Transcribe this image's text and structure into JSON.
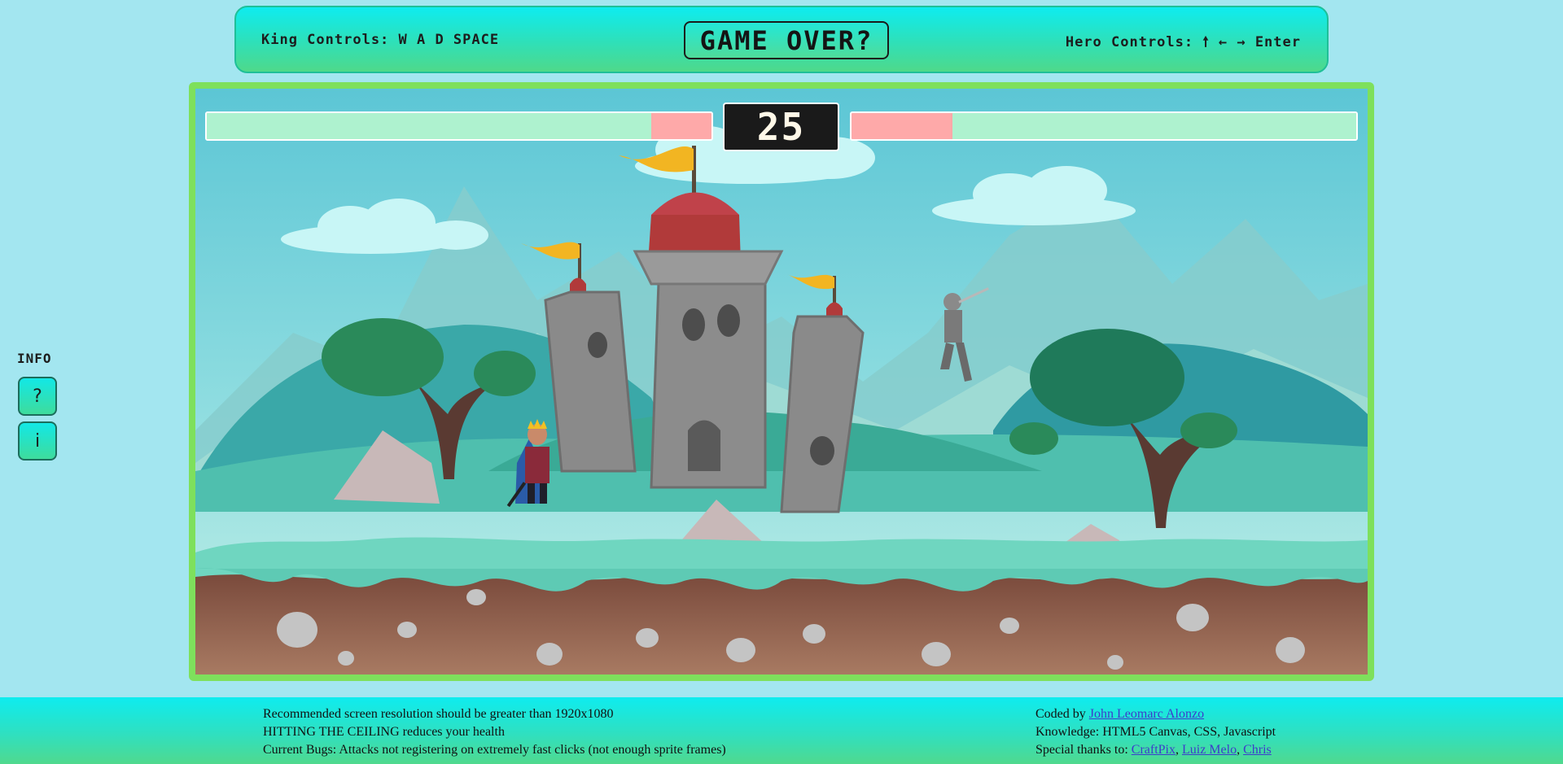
{
  "header": {
    "king_controls": "King Controls: W A D SPACE",
    "game_over": "GAME OVER?",
    "hero_controls": "Hero Controls: 🠕 ← → Enter"
  },
  "info": {
    "title": "INFO",
    "help_button": "?",
    "info_button": "i"
  },
  "hud": {
    "timer": "25",
    "king_health_fraction": 0.88,
    "hero_health_fraction": 0.8
  },
  "footer": {
    "left": {
      "line1": "Recommended screen resolution should be greater than 1920x1080",
      "line2": "HITTING THE CEILING reduces your health",
      "line3": "Current Bugs: Attacks not registering on extremely fast clicks (not enough sprite frames)"
    },
    "right": {
      "coded_by_prefix": "Coded by ",
      "coded_by_link": "John Leomarc Alonzo",
      "knowledge": "Knowledge: HTML5 Canvas, CSS, Javascript",
      "thanks_prefix": "Special thanks to: ",
      "thanks_1": "CraftPix",
      "sep_1": ", ",
      "thanks_2": "Luiz Melo",
      "sep_2": ", ",
      "thanks_3": "Chris"
    }
  },
  "colors": {
    "frame_border": "#7ee05c",
    "health_empty": "#fea9a9",
    "health_full": "#aef2cf"
  }
}
